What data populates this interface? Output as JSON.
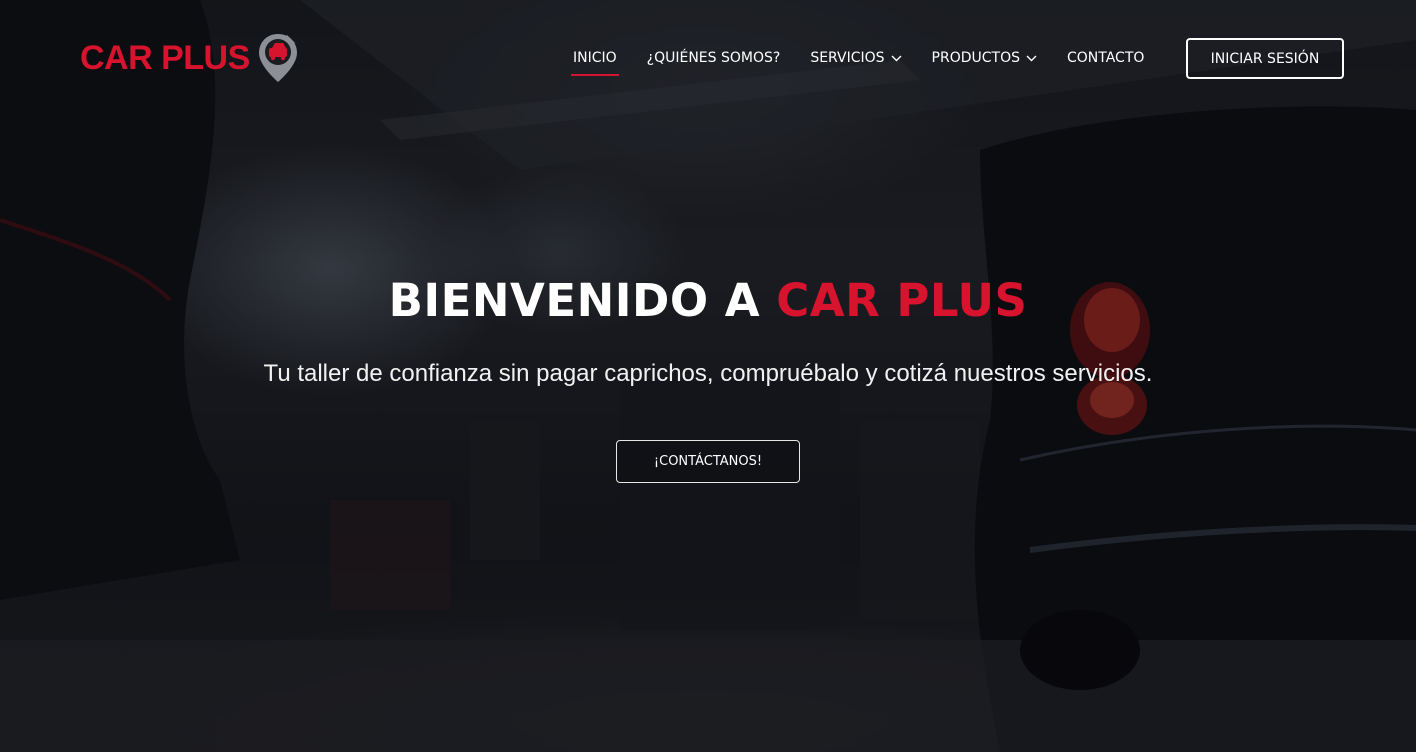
{
  "brand": {
    "logo_text": "CAR PLUS",
    "logo_icon": "map-pin-car-icon",
    "accent_color": "#d7132e"
  },
  "nav": {
    "items": [
      {
        "label": "INICIO",
        "active": true
      },
      {
        "label": "¿QUIÉNES SOMOS?"
      },
      {
        "label": "SERVICIOS",
        "icon": "chevron-down-icon"
      },
      {
        "label": "PRODUCTOS",
        "icon": "chevron-down-icon"
      },
      {
        "label": "CONTACTO"
      }
    ],
    "login_label": "INICIAR SESIÓN"
  },
  "hero": {
    "title_prefix": "BIENVENIDO A ",
    "title_accent": "CAR PLUS",
    "subtitle": "Tu taller de confianza sin pagar caprichos, compruébalo y cotizá nuestros servicios.",
    "cta_label": "¡CONTÁCTANOS!"
  }
}
